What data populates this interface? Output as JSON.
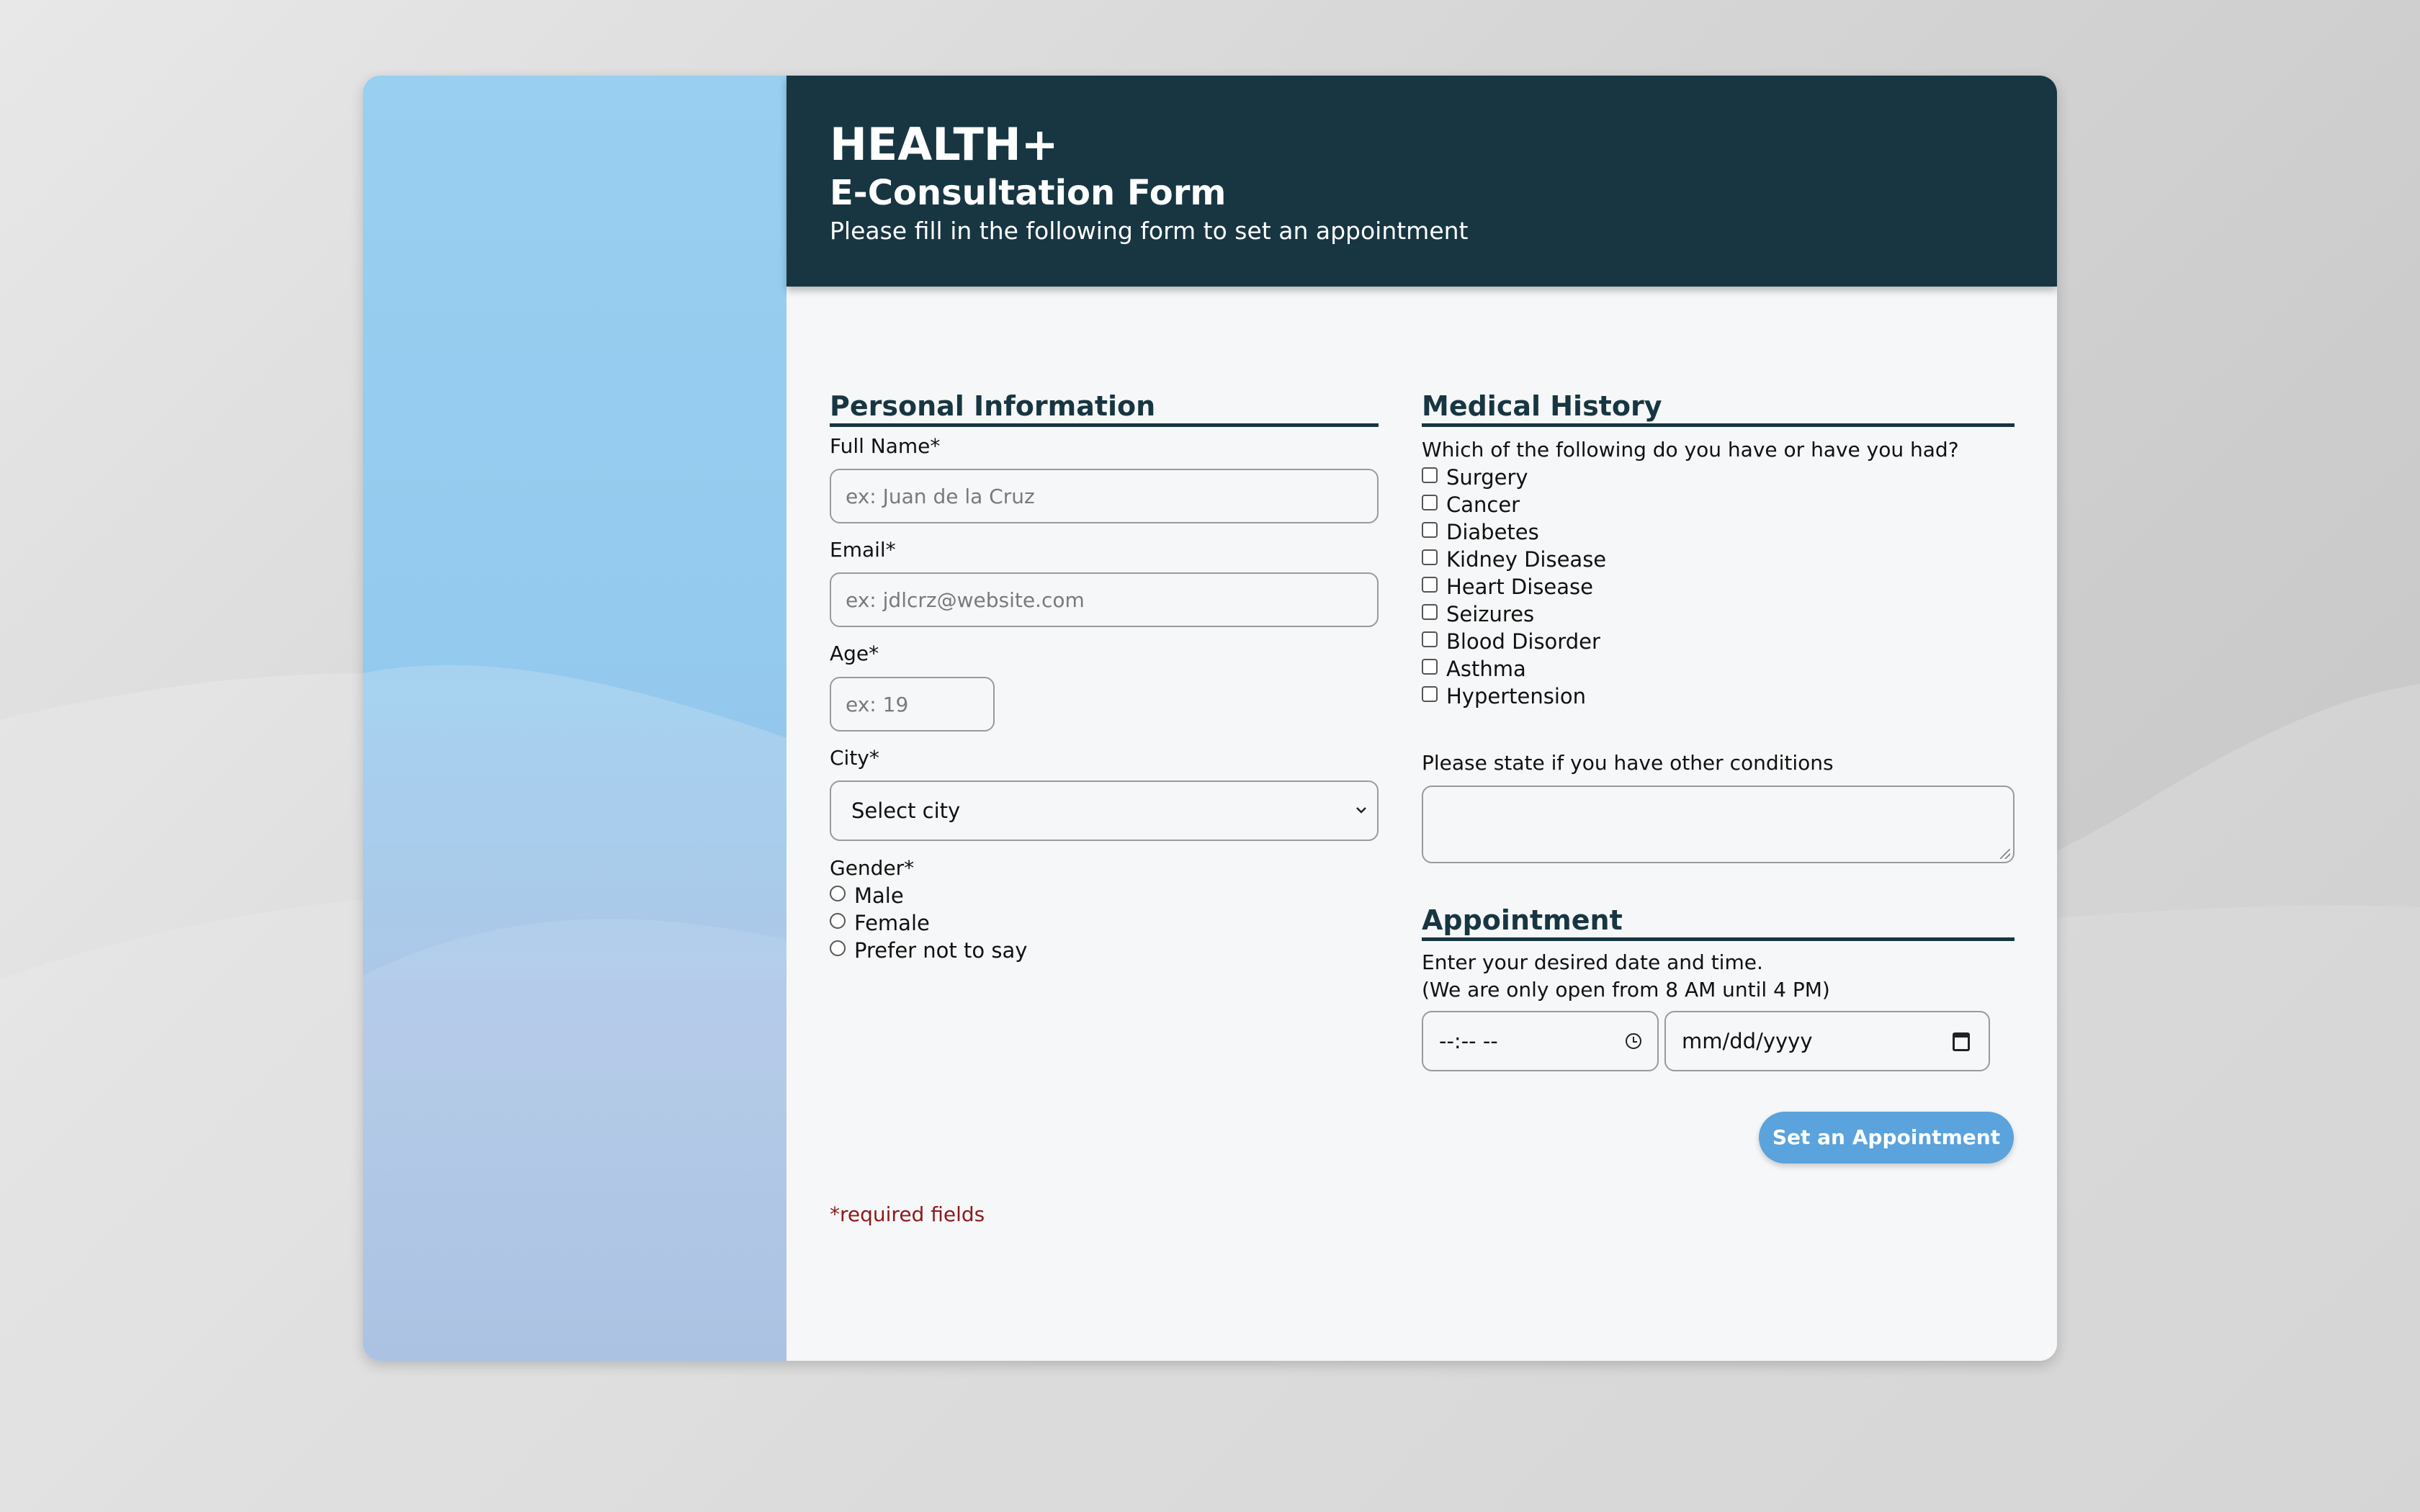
{
  "header": {
    "brand": "HEALTH+",
    "title": "E-Consultation Form",
    "subtitle": "Please fill in the following form to set an appointment"
  },
  "personal": {
    "section_title": "Personal Information",
    "full_name": {
      "label": "Full Name*",
      "placeholder": "ex: Juan de la Cruz"
    },
    "email": {
      "label": "Email*",
      "placeholder": "ex: jdlcrz@website.com"
    },
    "age": {
      "label": "Age*",
      "placeholder": "ex: 19"
    },
    "city": {
      "label": "City*",
      "selected": "Select city"
    },
    "gender": {
      "label": "Gender*",
      "options": [
        "Male",
        "Female",
        "Prefer not to say"
      ]
    },
    "required_note": "*required fields"
  },
  "medical": {
    "section_title": "Medical History",
    "question": "Which of the following do you have or have you had?",
    "conditions": [
      "Surgery",
      "Cancer",
      "Diabetes",
      "Kidney Disease",
      "Heart Disease",
      "Seizures",
      "Blood Disorder",
      "Asthma",
      "Hypertension"
    ],
    "other_label": "Please state if you have other conditions"
  },
  "appointment": {
    "section_title": "Appointment",
    "instruction": "Enter your desired date and time.",
    "hours_note": "(We are only open from 8 AM until 4 PM)",
    "time_placeholder": "--:-- --",
    "date_placeholder": "mm/dd/yyyy",
    "submit_label": "Set an Appointment"
  },
  "colors": {
    "header_bg": "#173642",
    "accent_button": "#5aa3dc",
    "required_text": "#8b1a1a",
    "side_panel": "#93caee"
  },
  "icons": {
    "city_select": "chevron-down-icon",
    "time": "clock-icon",
    "date": "calendar-icon"
  }
}
